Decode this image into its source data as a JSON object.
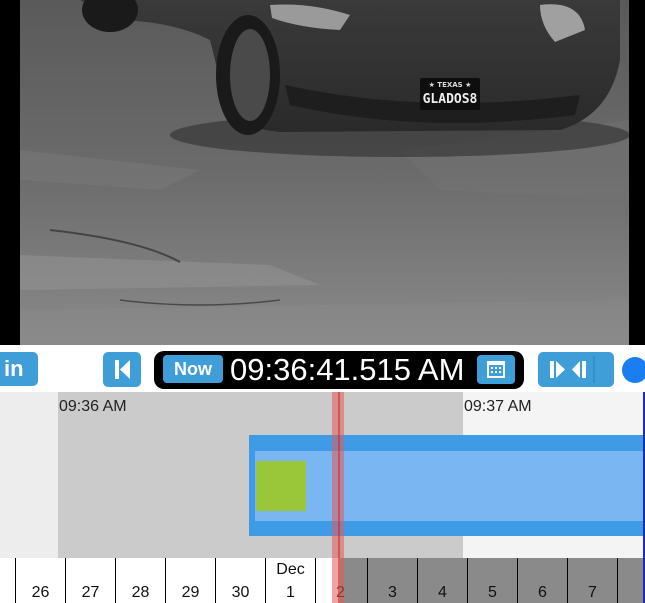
{
  "player": {
    "license_plate_state": "★ TEXAS ★",
    "license_plate_text": "GLADOS8"
  },
  "controls": {
    "in_label": "in",
    "now_label": "Now",
    "current_time": "09:36:41.515 AM",
    "icons": [
      "skip-to-start-icon",
      "calendar-icon",
      "step-forward-icon",
      "step-back-icon"
    ]
  },
  "timeline": {
    "tick_labels": [
      "09:36 AM",
      "09:37 AM"
    ],
    "days": [
      {
        "month": "",
        "day": "26"
      },
      {
        "month": "",
        "day": "27"
      },
      {
        "month": "",
        "day": "28"
      },
      {
        "month": "",
        "day": "29"
      },
      {
        "month": "",
        "day": "30"
      },
      {
        "month": "Dec",
        "day": "1"
      },
      {
        "month": "",
        "day": "2"
      },
      {
        "month": "",
        "day": "3"
      },
      {
        "month": "",
        "day": "4"
      },
      {
        "month": "",
        "day": "5"
      },
      {
        "month": "",
        "day": "6"
      },
      {
        "month": "",
        "day": "7"
      }
    ]
  },
  "colors": {
    "accent": "#3f9dd8",
    "recording_segment": "#3f9be5",
    "motion_marker": "#9ac73a",
    "playhead": "#e05a5a"
  }
}
